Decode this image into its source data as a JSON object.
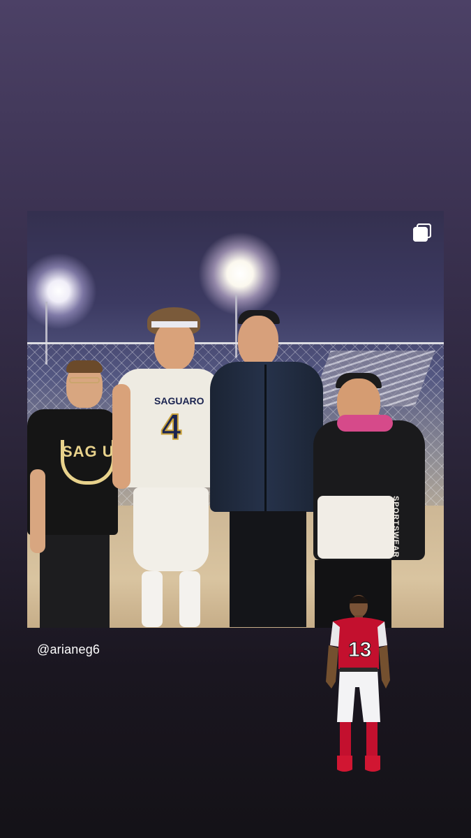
{
  "story": {
    "mention": "@arianeg6",
    "post_image": {
      "jersey_text": "SAGUARO",
      "jersey_number": "4",
      "shirt_text": "SAG U",
      "hoodie_text": "SPORTSWEAR",
      "multi_photo_icon": "carousel-icon"
    },
    "sticker": {
      "jersey_number": "13"
    }
  }
}
